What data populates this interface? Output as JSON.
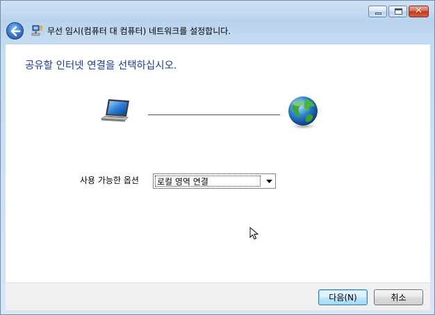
{
  "window": {
    "nav_title": "무선 임시(컴퓨터 대 컴퓨터) 네트워크를 설정합니다.",
    "caption_buttons": [
      "minimize",
      "maximize",
      "close"
    ]
  },
  "content": {
    "heading": "공유할 인터넷 연결을 선택하십시오.",
    "options_label": "사용 가능한 옵션",
    "selected_option": "로컬 영역 연결",
    "icons": [
      "laptop-icon",
      "globe-icon"
    ]
  },
  "footer": {
    "next_label": "다음(N)",
    "cancel_label": "취소"
  },
  "colors": {
    "heading": "#1b3e8f",
    "frame": "#c4dbf2"
  }
}
